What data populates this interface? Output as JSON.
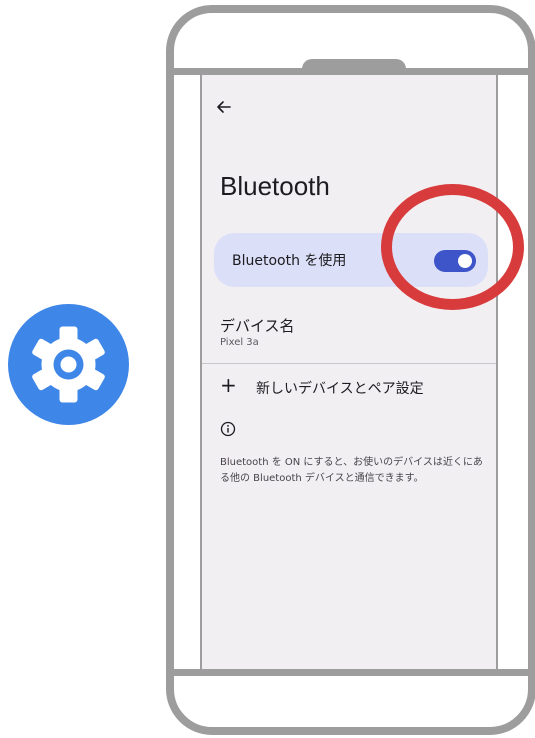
{
  "app_icon": {
    "name": "gear-icon",
    "color": "#3e86e8"
  },
  "screen": {
    "back_icon": "arrow-left-icon",
    "title": "Bluetooth",
    "toggle": {
      "label": "Bluetooth を使用",
      "state": "on",
      "accent": "#3d55c8",
      "card_color": "#dcdff8"
    },
    "device_name": {
      "title": "デバイス名",
      "value": "Pixel 3a"
    },
    "pair": {
      "icon": "plus-icon",
      "label": "新しいデバイスとペア設定"
    },
    "info": {
      "icon": "info-icon",
      "text": "Bluetooth を ON にすると、お使いのデバイスは近くにある他の Bluetooth デバイスと通信できます。"
    }
  },
  "highlight": {
    "color": "#d83b3b",
    "target": "bluetooth-toggle-switch"
  }
}
